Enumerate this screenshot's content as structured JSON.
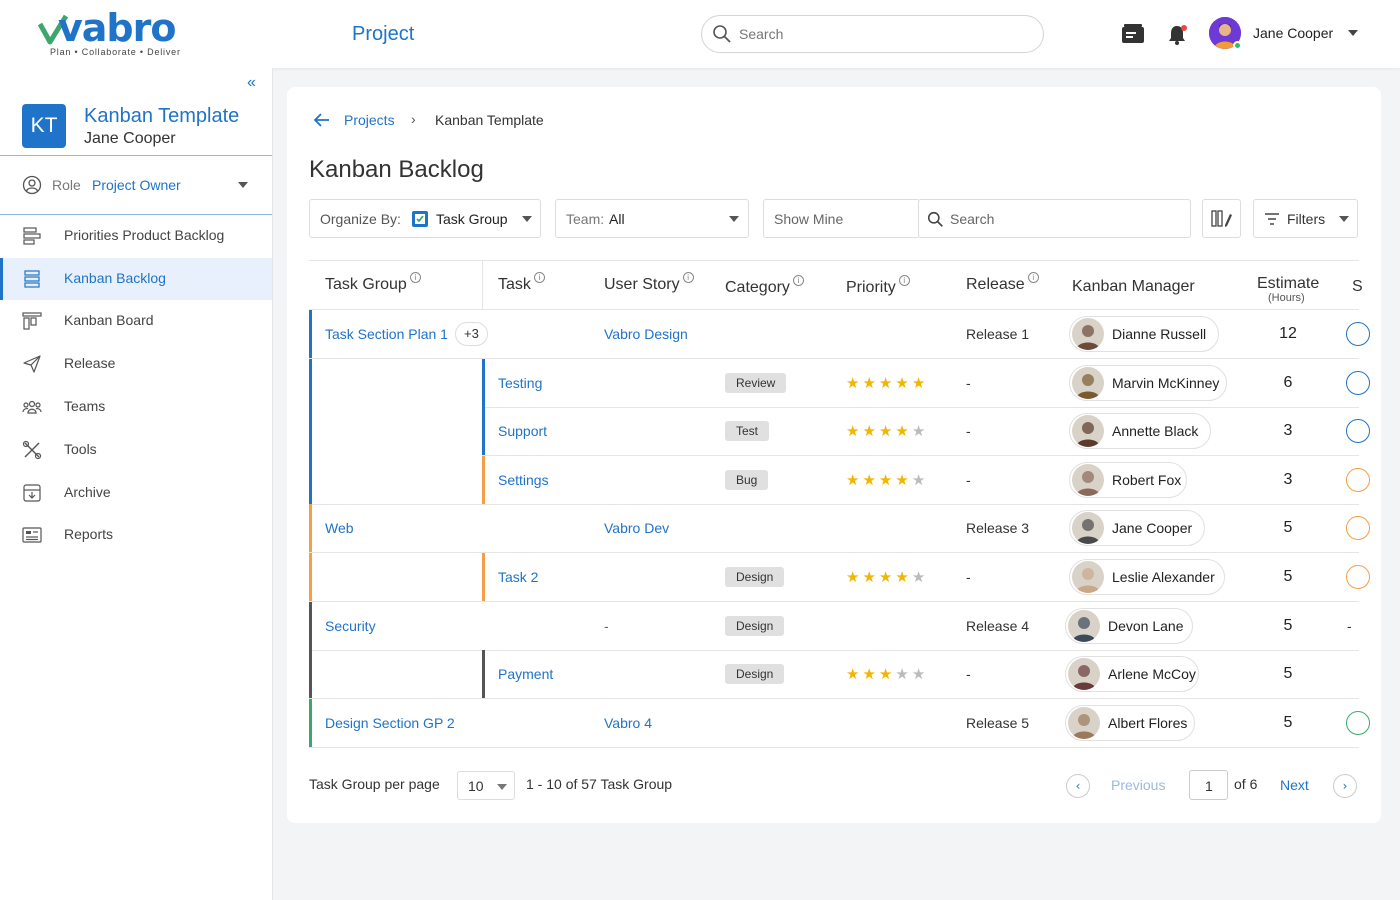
{
  "app": {
    "logo_text": "vabro",
    "logo_tagline": "Plan • Collaborate • Deliver",
    "header_title": "Project",
    "search_placeholder": "Search",
    "user_name": "Jane Cooper"
  },
  "sidebar": {
    "project_initials": "KT",
    "project_name": "Kanban Template",
    "project_owner": "Jane Cooper",
    "role_label": "Role",
    "role_value": "Project Owner",
    "items": [
      {
        "label": "Priorities Product Backlog",
        "icon": "priorities-icon",
        "active": false
      },
      {
        "label": "Kanban Backlog",
        "icon": "backlog-icon",
        "active": true
      },
      {
        "label": "Kanban Board",
        "icon": "board-icon",
        "active": false
      },
      {
        "label": "Release",
        "icon": "release-icon",
        "active": false
      },
      {
        "label": "Teams",
        "icon": "teams-icon",
        "active": false
      },
      {
        "label": "Tools",
        "icon": "tools-icon",
        "active": false
      },
      {
        "label": "Archive",
        "icon": "archive-icon",
        "active": false
      },
      {
        "label": "Reports",
        "icon": "reports-icon",
        "active": false
      }
    ]
  },
  "breadcrumb": {
    "parent": "Projects",
    "separator": "›",
    "current": "Kanban Template"
  },
  "page_title": "Kanban Backlog",
  "toolbar": {
    "organize_label": "Organize By:",
    "organize_value": "Task Group",
    "team_label": "Team:",
    "team_value": "All",
    "show_mine": "Show Mine",
    "search_placeholder": "Search",
    "filters_label": "Filters"
  },
  "columns": {
    "task_group": "Task Group",
    "task": "Task",
    "user_story": "User Story",
    "category": "Category",
    "priority": "Priority",
    "release": "Release",
    "kanban_manager": "Kanban Manager",
    "estimate": "Estimate",
    "estimate_unit": "(Hours)",
    "status_partial": "S"
  },
  "colors": {
    "accent": "#1f73c9",
    "group_blue": "#1f73c9",
    "group_orange": "#f59e45",
    "group_dark": "#555555",
    "group_green": "#3aa76d",
    "star": "#f2b600"
  },
  "rows": [
    {
      "type": "group",
      "task_group": "Task Section Plan 1",
      "extra": "+3",
      "user_story": "Vabro Design",
      "release": "Release 1",
      "manager": "Dianne Russell",
      "estimate": "12",
      "bar": "#1f73c9",
      "ring": "#1f73c9"
    },
    {
      "type": "task",
      "task": "Testing",
      "category": "Review",
      "priority": 5,
      "release": "-",
      "manager": "Marvin McKinney",
      "estimate": "6",
      "bar": "#1f73c9",
      "ring": "#1f73c9"
    },
    {
      "type": "task",
      "task": "Support",
      "category": "Test",
      "priority": 4,
      "release": "-",
      "manager": "Annette Black",
      "estimate": "3",
      "bar": "#1f73c9",
      "ring": "#1f73c9"
    },
    {
      "type": "task",
      "task": "Settings",
      "category": "Bug",
      "priority": 4,
      "release": "-",
      "manager": "Robert Fox",
      "estimate": "3",
      "bar": "#f59e45",
      "ring": "#f59e45"
    },
    {
      "type": "group",
      "task_group": "Web",
      "user_story": "Vabro Dev",
      "release": "Release 3",
      "manager": "Jane Cooper",
      "estimate": "5",
      "bar": "#f59e45",
      "ring": "#f59e45"
    },
    {
      "type": "task",
      "task": "Task 2",
      "category": "Design",
      "priority": 4,
      "release": "-",
      "manager": "Leslie Alexander",
      "estimate": "5",
      "bar": "#f59e45",
      "ring": "#f59e45"
    },
    {
      "type": "group",
      "task_group": "Security",
      "user_story": "-",
      "category": "Design",
      "release": "Release 4",
      "manager": "Devon Lane",
      "estimate": "5",
      "bar": "#555555",
      "status_text": "-"
    },
    {
      "type": "task",
      "task": "Payment",
      "category": "Design",
      "priority": 3,
      "release": "-",
      "manager": "Arlene McCoy",
      "estimate": "5",
      "bar": "#555555"
    },
    {
      "type": "group",
      "task_group": "Design Section GP 2",
      "user_story": "Vabro 4",
      "release": "Release 5",
      "manager": "Albert Flores",
      "estimate": "5",
      "bar": "#3aa76d",
      "ring": "#3aa76d"
    }
  ],
  "pagination": {
    "per_page_label": "Task Group per page",
    "per_page_value": "10",
    "range_label": "1 - 10 of 57 Task Group",
    "previous": "Previous",
    "current_page": "1",
    "of_label": "of 6",
    "next": "Next"
  }
}
